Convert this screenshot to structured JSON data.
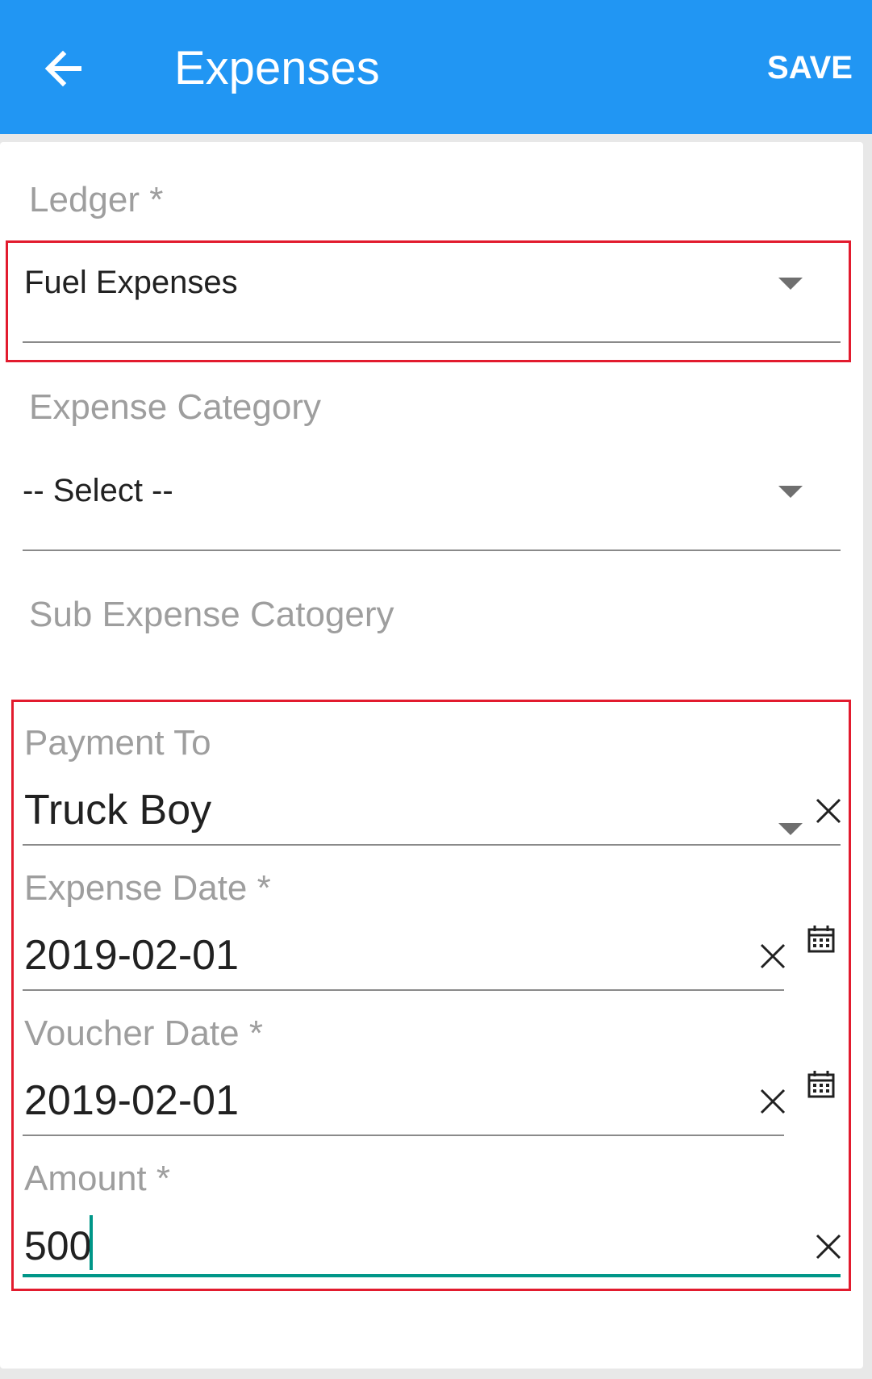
{
  "header": {
    "title": "Expenses",
    "save_label": "SAVE",
    "back_icon": "arrow-left-icon",
    "background": "#2196f3"
  },
  "form": {
    "ledger": {
      "label": "Ledger *",
      "value": "Fuel Expenses"
    },
    "expense_category": {
      "label": "Expense Category",
      "value": "-- Select --"
    },
    "sub_expense_category": {
      "label": "Sub Expense Catogery",
      "value": ""
    },
    "payment_to": {
      "label": "Payment To",
      "value": "Truck Boy"
    },
    "expense_date": {
      "label": "Expense Date *",
      "value": "2019-02-01"
    },
    "voucher_date": {
      "label": "Voucher Date *",
      "value": "2019-02-01"
    },
    "amount": {
      "label": "Amount *",
      "value": "500"
    }
  },
  "colors": {
    "accent": "#009688",
    "highlight": "#e21b2e",
    "label": "#9e9e9e"
  },
  "icons": {
    "dropdown": "caret-down-icon",
    "clear": "close-icon",
    "calendar": "calendar-icon"
  }
}
